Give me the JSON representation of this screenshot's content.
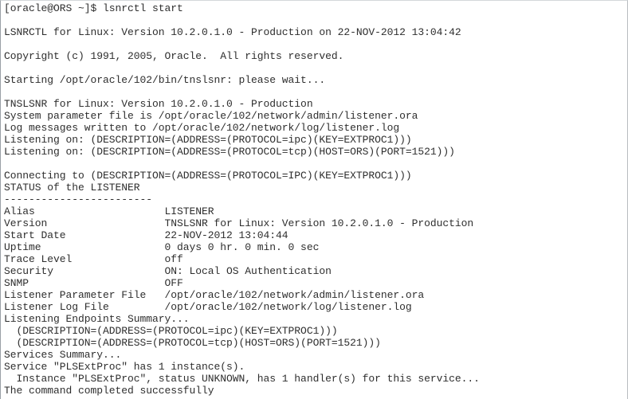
{
  "terminal": {
    "title": "lsnrctl start",
    "background_color": "#ffffff",
    "text_color": "#2e2e2e",
    "prompt": "[oracle@ORS ~]$",
    "command": "lsnrctl start",
    "lines": [
      "[oracle@ORS ~]$ lsnrctl start",
      "",
      "LSNRCTL for Linux: Version 10.2.0.1.0 - Production on 22-NOV-2012 13:04:42",
      "",
      "Copyright (c) 1991, 2005, Oracle.  All rights reserved.",
      "",
      "Starting /opt/oracle/102/bin/tnslsnr: please wait...",
      "",
      "TNSLSNR for Linux: Version 10.2.0.1.0 - Production",
      "System parameter file is /opt/oracle/102/network/admin/listener.ora",
      "Log messages written to /opt/oracle/102/network/log/listener.log",
      "Listening on: (DESCRIPTION=(ADDRESS=(PROTOCOL=ipc)(KEY=EXTPROC1)))",
      "Listening on: (DESCRIPTION=(ADDRESS=(PROTOCOL=tcp)(HOST=ORS)(PORT=1521)))",
      "",
      "Connecting to (DESCRIPTION=(ADDRESS=(PROTOCOL=IPC)(KEY=EXTPROC1)))",
      "STATUS of the LISTENER",
      "------------------------",
      "Alias                     LISTENER",
      "Version                   TNSLSNR for Linux: Version 10.2.0.1.0 - Production",
      "Start Date                22-NOV-2012 13:04:44",
      "Uptime                    0 days 0 hr. 0 min. 0 sec",
      "Trace Level               off",
      "Security                  ON: Local OS Authentication",
      "SNMP                      OFF",
      "Listener Parameter File   /opt/oracle/102/network/admin/listener.ora",
      "Listener Log File         /opt/oracle/102/network/log/listener.log",
      "Listening Endpoints Summary...",
      "  (DESCRIPTION=(ADDRESS=(PROTOCOL=ipc)(KEY=EXTPROC1)))",
      "  (DESCRIPTION=(ADDRESS=(PROTOCOL=tcp)(HOST=ORS)(PORT=1521)))",
      "Services Summary...",
      "Service \"PLSExtProc\" has 1 instance(s).",
      "  Instance \"PLSExtProc\", status UNKNOWN, has 1 handler(s) for this service...",
      "The command completed successfully"
    ],
    "status_table": {
      "header": "STATUS of the LISTENER",
      "separator": "------------------------",
      "rows": [
        {
          "label": "Alias",
          "value": "LISTENER"
        },
        {
          "label": "Version",
          "value": "TNSLSNR for Linux: Version 10.2.0.1.0 - Production"
        },
        {
          "label": "Start Date",
          "value": "22-NOV-2012 13:04:44"
        },
        {
          "label": "Uptime",
          "value": "0 days 0 hr. 0 min. 0 sec"
        },
        {
          "label": "Trace Level",
          "value": "off"
        },
        {
          "label": "Security",
          "value": "ON: Local OS Authentication"
        },
        {
          "label": "SNMP",
          "value": "OFF"
        },
        {
          "label": "Listener Parameter File",
          "value": "/opt/oracle/102/network/admin/listener.ora"
        },
        {
          "label": "Listener Log File",
          "value": "/opt/oracle/102/network/log/listener.log"
        }
      ]
    },
    "endpoints_summary": {
      "header": "Listening Endpoints Summary...",
      "entries": [
        "(DESCRIPTION=(ADDRESS=(PROTOCOL=ipc)(KEY=EXTPROC1)))",
        "(DESCRIPTION=(ADDRESS=(PROTOCOL=tcp)(HOST=ORS)(PORT=1521)))"
      ]
    },
    "services_summary": {
      "header": "Services Summary...",
      "service_line": "Service \"PLSExtProc\" has 1 instance(s).",
      "instance_line": "  Instance \"PLSExtProc\", status UNKNOWN, has 1 handler(s) for this service..."
    },
    "result": "The command completed successfully"
  }
}
